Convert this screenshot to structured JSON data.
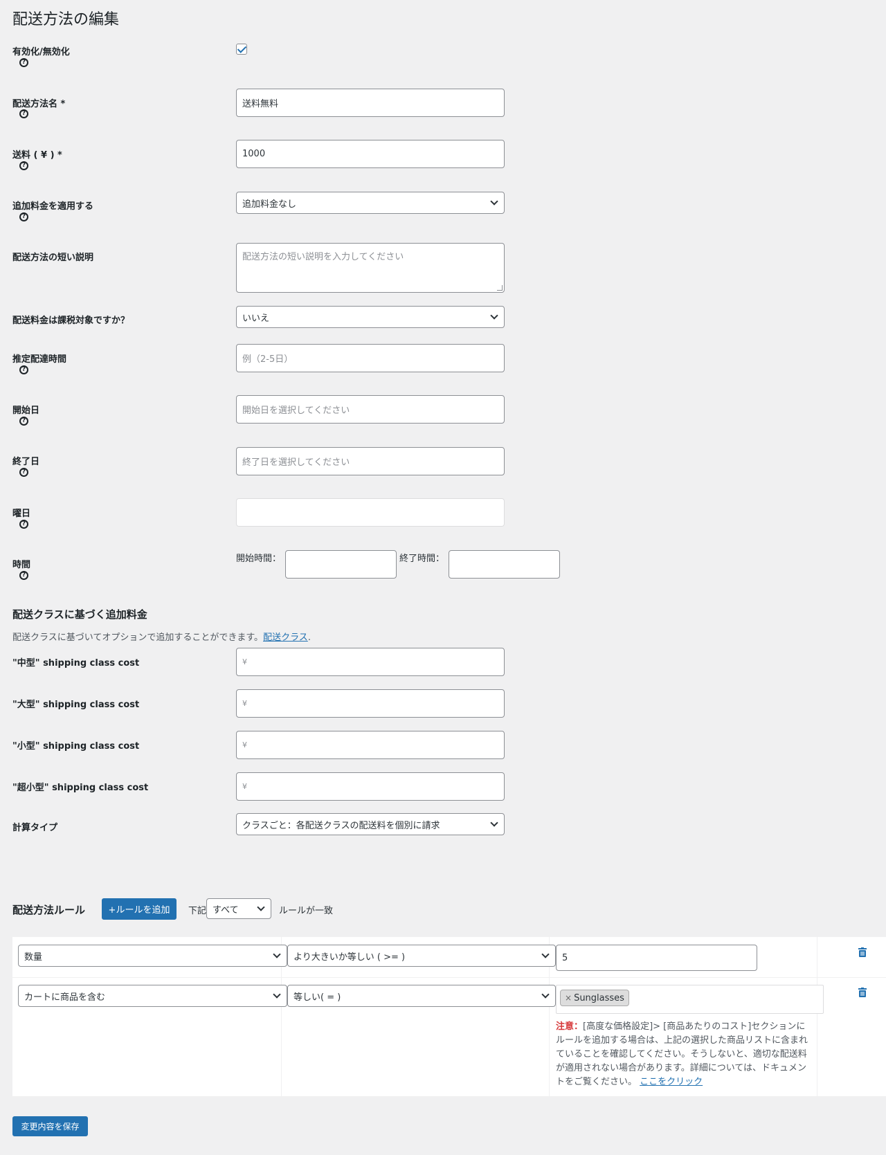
{
  "page": {
    "title": "配送方法の編集"
  },
  "form": {
    "enable": {
      "label": "有効化/無効化",
      "checked": true
    },
    "name": {
      "label": "配送方法名 *",
      "value": "送料無料"
    },
    "cost": {
      "label": "送料 ( ¥ ) *",
      "value": "1000"
    },
    "extra_fee": {
      "label": "追加料金を適用する",
      "value": "追加料金なし"
    },
    "short_desc": {
      "label": "配送方法の短い説明",
      "placeholder": "配送方法の短い説明を入力してください"
    },
    "taxable": {
      "label": "配送料金は課税対象ですか？",
      "value": "いいえ"
    },
    "est_time": {
      "label": "推定配達時間",
      "placeholder": "例（2-5日）"
    },
    "start_date": {
      "label": "開始日",
      "placeholder": "開始日を選択してください"
    },
    "end_date": {
      "label": "終了日",
      "placeholder": "終了日を選択してください"
    },
    "weekday": {
      "label": "曜日"
    },
    "time": {
      "label": "時間",
      "start_label": "開始時間：",
      "end_label": "終了時間："
    }
  },
  "class_costs": {
    "title": "配送クラスに基づく追加料金",
    "desc": "配送クラスに基づいてオプションで追加することができます。",
    "link": "配送クラス",
    "link_suffix": ".",
    "items": [
      {
        "label": "\"中型\" shipping class cost",
        "placeholder": "¥"
      },
      {
        "label": "\"大型\" shipping class cost",
        "placeholder": "¥"
      },
      {
        "label": "\"小型\" shipping class cost",
        "placeholder": "¥"
      },
      {
        "label": "\"超小型\" shipping class cost",
        "placeholder": "¥"
      }
    ],
    "calc_type": {
      "label": "計算タイプ",
      "value": "クラスごと：各配送クラスの配送料を個別に請求"
    }
  },
  "rules": {
    "title": "配送方法ルール",
    "add_button": "+ルールを追加",
    "match_prefix": "下記",
    "match_value": "すべて",
    "match_suffix": "ルールが一致",
    "rows": [
      {
        "condition": "数量",
        "operator": "より大きいか等しい ( >= )",
        "value": "5"
      },
      {
        "condition": "カートに商品を含む",
        "operator": "等しい( = )",
        "tag": "Sunglasses"
      }
    ],
    "tag_remove": "×",
    "note_label": "注意：",
    "note_text": "[高度な価格設定]> [商品あたりのコスト]セクションにルールを追加する場合は、上記の選択した商品リストに含まれていることを確認してください。そうしないと、適切な配送料が適用されない場合があります。詳細については、ドキュメントをご覧ください。",
    "note_link": "ここをクリック"
  },
  "save_button": "変更内容を保存",
  "colors": {
    "primary": "#2271b1",
    "background": "#f0f0f1",
    "warning": "#d63638"
  }
}
